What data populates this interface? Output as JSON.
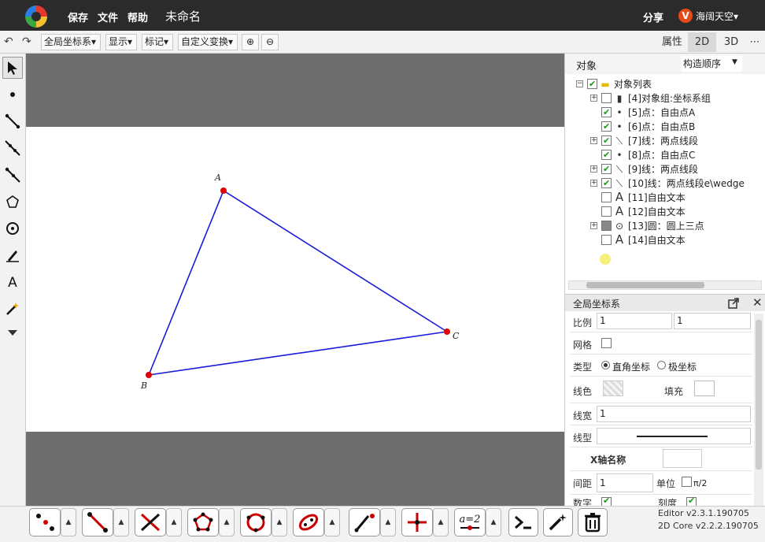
{
  "app": {
    "menu": [
      "保存",
      "文件",
      "帮助"
    ],
    "doc_title": "未命名",
    "share": "分享",
    "user_initial": "V",
    "user_name": "海阔天空▾"
  },
  "toolbar": {
    "undo": "↶",
    "redo": "↷",
    "coord_menu": "全局坐标系▾",
    "display_menu": "显示▾",
    "mark_menu": "标记▾",
    "transform_menu": "自定义变换▾",
    "zoom_in": "⊕",
    "zoom_out": "⊖",
    "tabs": [
      "属性",
      "2D",
      "3D"
    ],
    "more": "⋯"
  },
  "canvas": {
    "points": [
      {
        "label": "A"
      },
      {
        "label": "B"
      },
      {
        "label": "C"
      }
    ],
    "colors": {
      "segment": "#1a1adb",
      "point": "#e00000",
      "band": "#6e6e6e"
    }
  },
  "objects_panel": {
    "title": "对象",
    "order": "构造顺序",
    "order_arrow": "▼",
    "root_label": "对象列表",
    "items": [
      {
        "label": "[4]对象组:坐标系组",
        "icon": "bar-chart-icon",
        "glyph": "▮",
        "checked": false,
        "expander": true
      },
      {
        "label": "[5]点：自由点A",
        "icon": "point-icon",
        "glyph": "•",
        "checked": true,
        "expander": false
      },
      {
        "label": "[6]点：自由点B",
        "icon": "point-icon",
        "glyph": "•",
        "checked": true,
        "expander": false
      },
      {
        "label": "[7]线：两点线段",
        "icon": "segment-icon",
        "glyph": "⟍",
        "checked": true,
        "expander": true
      },
      {
        "label": "[8]点：自由点C",
        "icon": "point-icon",
        "glyph": "•",
        "checked": true,
        "expander": false
      },
      {
        "label": "[9]线：两点线段",
        "icon": "segment-icon",
        "glyph": "⟍",
        "checked": true,
        "expander": true
      },
      {
        "label": "[10]线：两点线段e\\wedge",
        "icon": "segment-icon",
        "glyph": "⟍",
        "checked": true,
        "expander": true
      },
      {
        "label": "[11]自由文本",
        "icon": "text-icon",
        "glyph": "A",
        "checked": false,
        "expander": false
      },
      {
        "label": "[12]自由文本",
        "icon": "text-icon",
        "glyph": "A",
        "checked": false,
        "expander": false
      },
      {
        "label": "[13]圆：圆上三点",
        "icon": "circle-icon",
        "glyph": "⊙",
        "checked": false,
        "expander": true
      },
      {
        "label": "[14]自由文本",
        "icon": "text-icon",
        "glyph": "A",
        "checked": false,
        "expander": false
      }
    ]
  },
  "properties": {
    "title": "全局坐标系",
    "scale_label": "比例",
    "scale_x": "1",
    "scale_y": "1",
    "grid_label": "网格",
    "type_label": "类型",
    "type_rect": "直角坐标",
    "type_polar": "极坐标",
    "line_color_label": "线色",
    "fill_label": "填充",
    "line_width_label": "线宽",
    "line_width": "1",
    "line_style_label": "线型",
    "x_axis_name_label": "X轴名称",
    "spacing_label": "间距",
    "spacing": "1",
    "unit_label": "单位",
    "unit_value": "π/2",
    "number_label": "数字",
    "tick_label": "刻度"
  },
  "bottom": {
    "version_editor": "Editor v2.3.1.190705",
    "version_core": "2D Core v2.2.2.190705",
    "formula": "a=2"
  }
}
